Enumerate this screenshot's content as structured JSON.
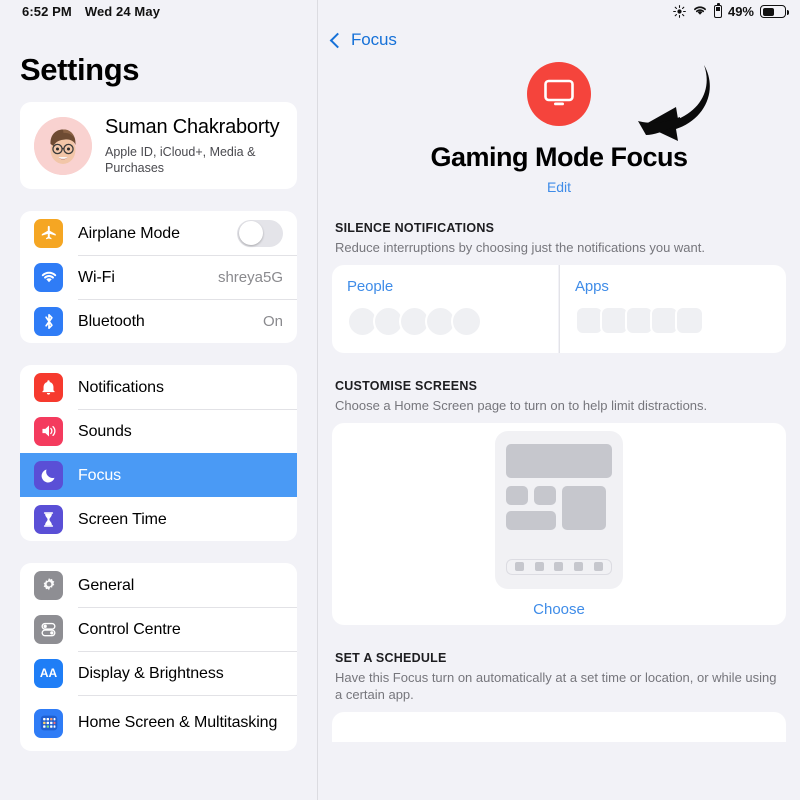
{
  "status_bar": {
    "time": "6:52 PM",
    "date": "Wed 24 May",
    "battery_percent": "49%",
    "icons": [
      "brightness-icon",
      "wifi-icon",
      "battery-charging-icon",
      "battery-icon"
    ]
  },
  "sidebar": {
    "title": "Settings",
    "profile": {
      "name": "Suman Chakraborty",
      "subtitle": "Apple ID, iCloud+, Media & Purchases",
      "avatar": "memoji-avatar"
    },
    "group_connectivity": [
      {
        "label": "Airplane Mode",
        "icon": "airplane-icon",
        "icon_color": "#f5a623",
        "control": "toggle",
        "value": "off"
      },
      {
        "label": "Wi-Fi",
        "icon": "wifi-icon",
        "icon_color": "#2f7cf6",
        "value": "shreya5G"
      },
      {
        "label": "Bluetooth",
        "icon": "bluetooth-icon",
        "icon_color": "#2f7cf6",
        "value": "On"
      }
    ],
    "group_alerts": [
      {
        "label": "Notifications",
        "icon": "bell-icon",
        "icon_color": "#f63a2e",
        "selected": false
      },
      {
        "label": "Sounds",
        "icon": "speaker-icon",
        "icon_color": "#f43b5e",
        "selected": false
      },
      {
        "label": "Focus",
        "icon": "moon-icon",
        "icon_color": "#5a4fd6",
        "selected": true
      },
      {
        "label": "Screen Time",
        "icon": "hourglass-icon",
        "icon_color": "#5a4fd6",
        "selected": false
      }
    ],
    "group_system": [
      {
        "label": "General",
        "icon": "gear-icon",
        "icon_color": "#8e8e93"
      },
      {
        "label": "Control Centre",
        "icon": "switches-icon",
        "icon_color": "#8e8e93"
      },
      {
        "label": "Display & Brightness",
        "icon": "aa-icon",
        "icon_color": "#1f7ef6"
      },
      {
        "label": "Home Screen & Multitasking",
        "icon": "app-grid-icon",
        "icon_color": "#2f7cf6"
      }
    ]
  },
  "detail": {
    "back_label": "Focus",
    "focus_name": "Gaming Mode Focus",
    "edit_label": "Edit",
    "focus_icon": "display-monitor-icon",
    "focus_icon_color": "#f5443c",
    "annotation": "curved-arrow-pointing-left",
    "silence": {
      "header": "SILENCE NOTIFICATIONS",
      "description": "Reduce interruptions by choosing just the notifications you want.",
      "people_label": "People",
      "apps_label": "Apps"
    },
    "customise": {
      "header": "CUSTOMISE SCREENS",
      "description": "Choose a Home Screen page to turn on to help limit distractions.",
      "choose_label": "Choose"
    },
    "schedule": {
      "header": "SET A SCHEDULE",
      "description": "Have this Focus turn on automatically at a set time or location, or while using a certain app."
    }
  }
}
